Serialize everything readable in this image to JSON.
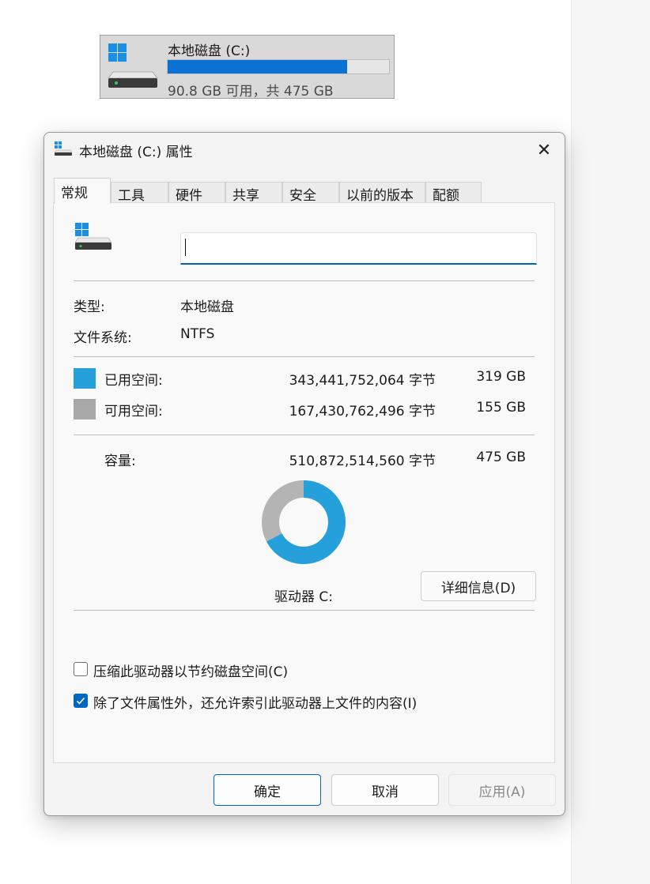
{
  "drive_tile": {
    "name": "本地磁盘 (C:)",
    "used_fraction": 0.81,
    "free_text": "90.8 GB 可用，共 475 GB",
    "icon": "hard-drive-icon"
  },
  "dialog": {
    "title": "本地磁盘 (C:) 属性",
    "icon": "hard-drive-icon",
    "close": "✕",
    "tabs": [
      {
        "label": "常规",
        "active": true
      },
      {
        "label": "工具"
      },
      {
        "label": "硬件"
      },
      {
        "label": "共享"
      },
      {
        "label": "安全"
      },
      {
        "label": "以前的版本"
      },
      {
        "label": "配额"
      }
    ],
    "name_value": "",
    "type_label": "类型:",
    "type_value": "本地磁盘",
    "fs_label": "文件系统:",
    "fs_value": "NTFS",
    "used": {
      "label": "已用空间:",
      "bytes": "343,441,752,064 字节",
      "size": "319 GB",
      "color": "#26a0da"
    },
    "free": {
      "label": "可用空间:",
      "bytes": "167,430,762,496 字节",
      "size": "155 GB",
      "color": "#a8a8a8"
    },
    "capacity": {
      "label": "容量:",
      "bytes": "510,872,514,560 字节",
      "size": "475 GB"
    },
    "drive_label": "驱动器 C:",
    "details_button": "详细信息(D)",
    "compress_option": {
      "label": "压缩此驱动器以节约磁盘空间(C)",
      "checked": false
    },
    "index_option": {
      "label": "除了文件属性外，还允许索引此驱动器上文件的内容(I)",
      "checked": true
    },
    "ok": "确定",
    "cancel": "取消",
    "apply": "应用(A)"
  },
  "colors": {
    "accent": "#0067c0",
    "used": "#26a0da",
    "free": "#a8a8a8",
    "bar_fill": "#0b72d3"
  }
}
